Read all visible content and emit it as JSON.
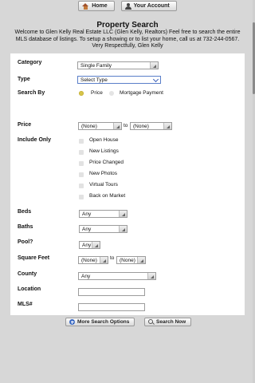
{
  "nav": {
    "home_label": "Home",
    "account_label": "Your Account"
  },
  "header": {
    "title": "Property Search",
    "intro": "Welcome to Glen Kelly Real Estate LLC (Glen Kelly, Realtors) Feel free to search the entire MLS database of listings. To setup a showing or to list your home, call us at 732-244-0567. Very Respectfully, Glen Kelly"
  },
  "form": {
    "category": {
      "label": "Category",
      "value": "Single Family"
    },
    "type": {
      "label": "Type",
      "value": "Select Type"
    },
    "search_by": {
      "label": "Search By",
      "options": [
        "Price",
        "Mortgage Payment"
      ],
      "selected": "Price"
    },
    "price": {
      "label": "Price",
      "min": "(None)",
      "to": "to",
      "max": "(None)"
    },
    "include_only": {
      "label": "Include Only",
      "options": [
        "Open House",
        "New Listings",
        "Price Changed",
        "New Photos",
        "Virtual Tours",
        "Back on Market"
      ]
    },
    "beds": {
      "label": "Beds",
      "value": "Any"
    },
    "baths": {
      "label": "Baths",
      "value": "Any"
    },
    "pool": {
      "label": "Pool?",
      "value": "Any"
    },
    "square_feet": {
      "label": "Square Feet",
      "min": "(None)",
      "to": "to",
      "max": "(None)"
    },
    "county": {
      "label": "County",
      "value": "Any"
    },
    "location": {
      "label": "Location",
      "value": ""
    },
    "mls": {
      "label": "MLS#",
      "value": ""
    }
  },
  "actions": {
    "more_options_label": "More Search Options",
    "search_label": "Search Now"
  },
  "colors": {
    "background": "#d7d7d7",
    "panel": "#ffffff",
    "radio_selected": "#d7c54a",
    "accent_blue": "#3c6bc4"
  }
}
